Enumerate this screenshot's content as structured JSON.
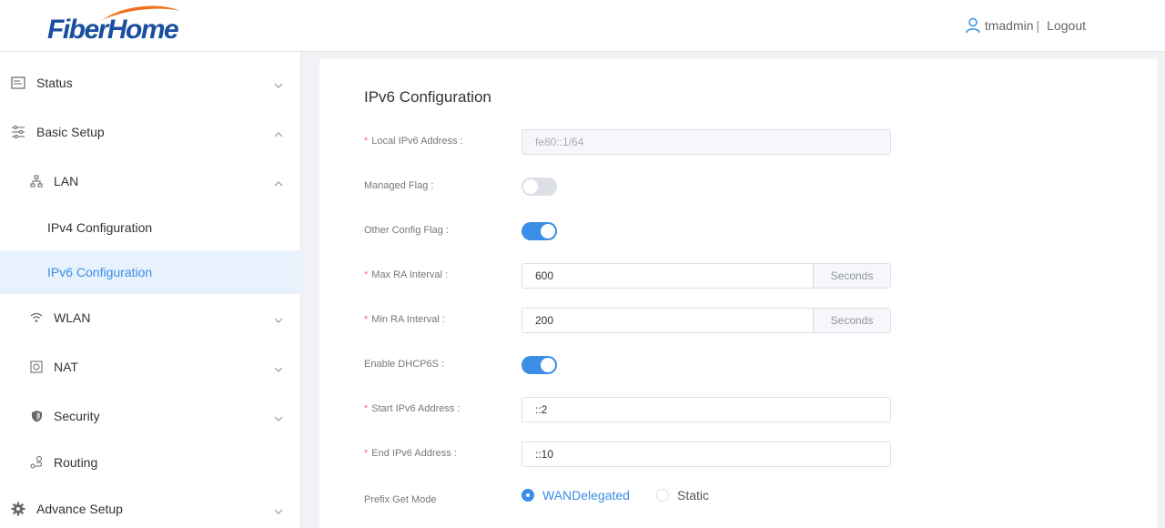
{
  "header": {
    "logo_text": "FiberHome",
    "username": "tmadmin",
    "separator": "|",
    "logout": "Logout"
  },
  "sidebar": {
    "status": "Status",
    "basic_setup": "Basic Setup",
    "lan": "LAN",
    "ipv4_config": "IPv4 Configuration",
    "ipv6_config": "IPv6 Configuration",
    "wlan": "WLAN",
    "nat": "NAT",
    "security": "Security",
    "routing": "Routing",
    "advance_setup": "Advance Setup"
  },
  "form": {
    "title": "IPv6 Configuration",
    "required_mark": "*",
    "local_ipv6_label": "Local IPv6 Address :",
    "local_ipv6_value": "fe80::1/64",
    "managed_flag_label": "Managed Flag :",
    "managed_flag_on": false,
    "other_config_label": "Other Config Flag :",
    "other_config_on": true,
    "max_ra_label": "Max RA Interval :",
    "max_ra_value": "600",
    "min_ra_label": "Min RA Interval :",
    "min_ra_value": "200",
    "seconds_unit": "Seconds",
    "enable_dhcp_label": "Enable DHCP6S :",
    "enable_dhcp_on": true,
    "start_ipv6_label": "Start IPv6 Address :",
    "start_ipv6_value": "::2",
    "end_ipv6_label": "End IPv6 Address :",
    "end_ipv6_value": "::10",
    "prefix_mode_label": "Prefix Get Mode",
    "prefix_options": [
      "WANDelegated",
      "Static"
    ],
    "prefix_selected": "WANDelegated"
  },
  "colors": {
    "accent": "#3a8ee6",
    "logo_blue": "#1a4fa0",
    "logo_orange": "#f07020",
    "required": "#f56c6c"
  }
}
